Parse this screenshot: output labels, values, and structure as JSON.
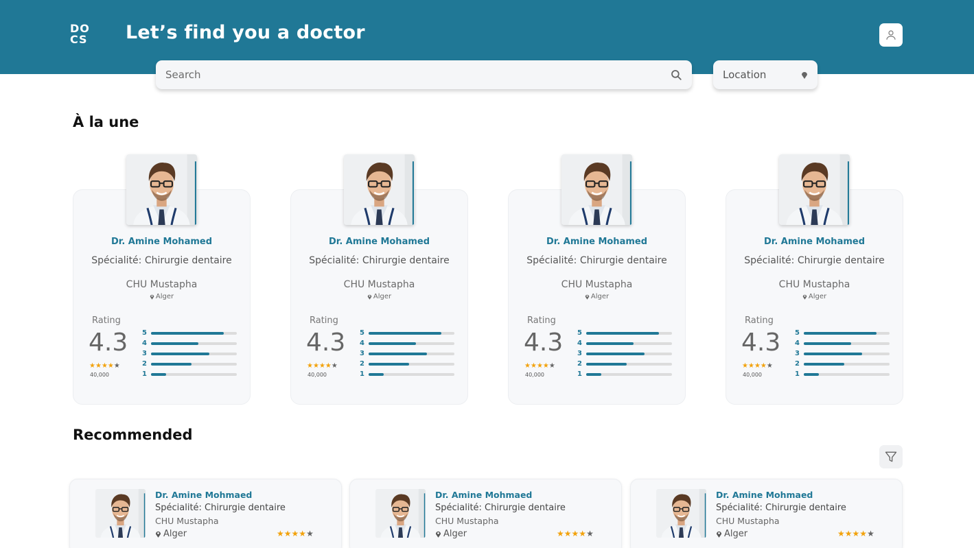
{
  "brand": {
    "logo_line1": "DO",
    "logo_line2": "CS",
    "title": "Let’s find you a doctor"
  },
  "search": {
    "placeholder": "Search",
    "icon": "search-icon"
  },
  "location": {
    "label": "Location",
    "icon": "location-pin-icon"
  },
  "colors": {
    "primary": "#207896",
    "star": "#f2a20c",
    "star_off": "#666666",
    "card_bg": "#f7f8fa"
  },
  "featured": {
    "title": "À la une",
    "cards": [
      {
        "name": "Dr. Amine Mohamed",
        "specialty": "Spécialité: Chirurgie dentaire",
        "hospital": "CHU Mustapha",
        "city": "Alger",
        "rating_label": "Rating",
        "rating": "4.3",
        "stars": 4,
        "reviews": "40,000",
        "distribution": [
          {
            "label": "5",
            "fill": 0.85
          },
          {
            "label": "4",
            "fill": 0.55
          },
          {
            "label": "3",
            "fill": 0.68
          },
          {
            "label": "2",
            "fill": 0.47
          },
          {
            "label": "1",
            "fill": 0.18
          }
        ]
      },
      {
        "name": "Dr. Amine Mohamed",
        "specialty": "Spécialité: Chirurgie dentaire",
        "hospital": "CHU Mustapha",
        "city": "Alger",
        "rating_label": "Rating",
        "rating": "4.3",
        "stars": 4,
        "reviews": "40,000",
        "distribution": [
          {
            "label": "5",
            "fill": 0.85
          },
          {
            "label": "4",
            "fill": 0.55
          },
          {
            "label": "3",
            "fill": 0.68
          },
          {
            "label": "2",
            "fill": 0.47
          },
          {
            "label": "1",
            "fill": 0.18
          }
        ]
      },
      {
        "name": "Dr. Amine Mohamed",
        "specialty": "Spécialité: Chirurgie dentaire",
        "hospital": "CHU Mustapha",
        "city": "Alger",
        "rating_label": "Rating",
        "rating": "4.3",
        "stars": 4,
        "reviews": "40,000",
        "distribution": [
          {
            "label": "5",
            "fill": 0.85
          },
          {
            "label": "4",
            "fill": 0.55
          },
          {
            "label": "3",
            "fill": 0.68
          },
          {
            "label": "2",
            "fill": 0.47
          },
          {
            "label": "1",
            "fill": 0.18
          }
        ]
      },
      {
        "name": "Dr. Amine Mohamed",
        "specialty": "Spécialité: Chirurgie dentaire",
        "hospital": "CHU Mustapha",
        "city": "Alger",
        "rating_label": "Rating",
        "rating": "4.3",
        "stars": 4,
        "reviews": "40,000",
        "distribution": [
          {
            "label": "5",
            "fill": 0.85
          },
          {
            "label": "4",
            "fill": 0.55
          },
          {
            "label": "3",
            "fill": 0.68
          },
          {
            "label": "2",
            "fill": 0.47
          },
          {
            "label": "1",
            "fill": 0.18
          }
        ]
      }
    ]
  },
  "recommended": {
    "title": "Recommended",
    "filter_icon": "filter-icon",
    "cards": [
      {
        "name": "Dr. Amine Mohmaed",
        "specialty": "Spécialité: Chirurgie dentaire",
        "hospital": "CHU Mustapha",
        "city": "Alger",
        "stars": 4
      },
      {
        "name": "Dr. Amine Mohmaed",
        "specialty": "Spécialité: Chirurgie dentaire",
        "hospital": "CHU Mustapha",
        "city": "Alger",
        "stars": 4
      },
      {
        "name": "Dr. Amine Mohmaed",
        "specialty": "Spécialité: Chirurgie dentaire",
        "hospital": "CHU Mustapha",
        "city": "Alger",
        "stars": 4
      }
    ]
  }
}
